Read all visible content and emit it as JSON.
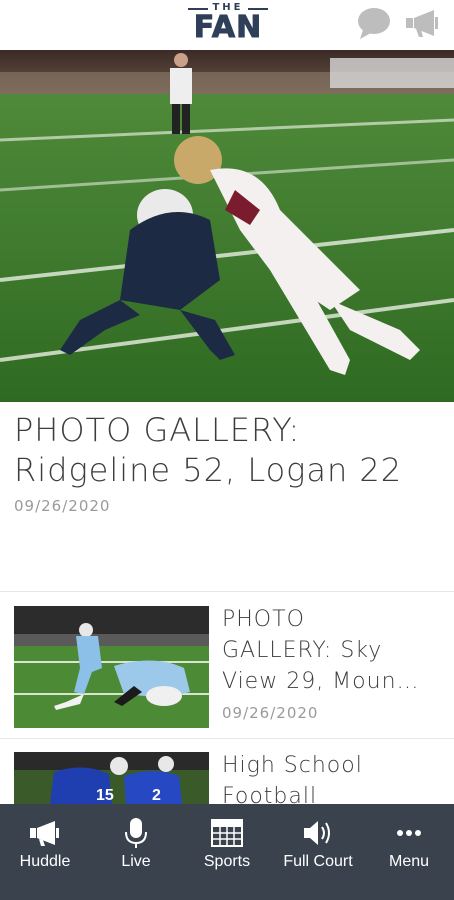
{
  "header": {
    "logo_top": "THE",
    "logo_main": "FAN",
    "icons": [
      "chat-bubble-icon",
      "megaphone-icon"
    ]
  },
  "hero": {
    "title_line1": "PHOTO GALLERY:",
    "title_line2": "Ridgeline 52, Logan 22",
    "date": "09/26/2020"
  },
  "articles": [
    {
      "title_lines": [
        "PHOTO",
        "GALLERY: Sky",
        "View 29, Moun…"
      ],
      "date": "09/26/2020"
    },
    {
      "title_lines": [
        "High School",
        "Football"
      ],
      "date": ""
    }
  ],
  "tabbar": {
    "tabs": [
      {
        "label": "Huddle",
        "icon": "megaphone-icon"
      },
      {
        "label": "Live",
        "icon": "microphone-icon"
      },
      {
        "label": "Sports",
        "icon": "scoreboard-icon"
      },
      {
        "label": "Full Court",
        "icon": "speaker-icon"
      },
      {
        "label": "Menu",
        "icon": "more-dots-icon"
      }
    ]
  },
  "colors": {
    "brand_navy": "#2f3f5a",
    "tabbar_bg": "#39424d",
    "field_green": "#3f7a2c",
    "date_gray": "#9a9a9a"
  }
}
